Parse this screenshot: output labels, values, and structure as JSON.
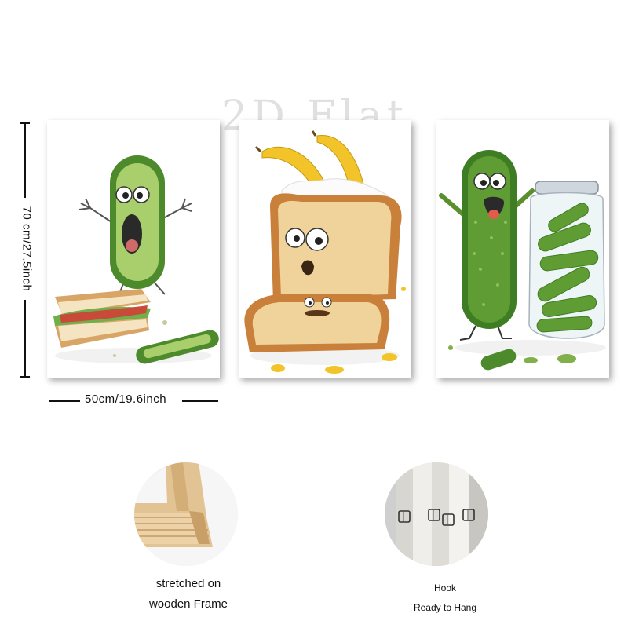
{
  "watermark": "2D Flat",
  "dimensions": {
    "height_label": "70 cm/27.5inch",
    "width_label": "50cm/19.6inch"
  },
  "features": [
    {
      "line1": "stretched on",
      "line2": "wooden Frame",
      "icon": "wooden-frame-photo"
    },
    {
      "line1": "Hook",
      "line2": "Ready to Hang",
      "icon": "hook-photo"
    }
  ],
  "colors": {
    "cucumber": "#4d8a2c",
    "cucumber_light": "#a9cf6d",
    "bread_crust": "#c9803a",
    "bread_inside": "#f0d39a",
    "banana": "#f2c42a",
    "wood": "#e2c394"
  }
}
